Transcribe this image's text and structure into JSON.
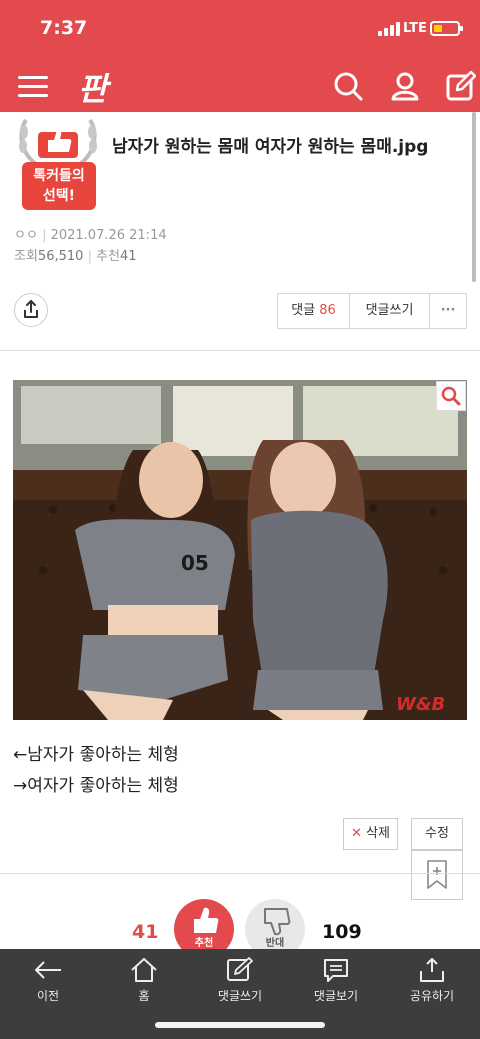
{
  "status_bar": {
    "time": "7:37",
    "network": "LTE"
  },
  "header": {
    "logo": "판"
  },
  "article": {
    "badge": {
      "line1": "톡커들의",
      "line2": "선택!"
    },
    "title": "남자가 원하는 몸매 여자가 원하는 몸매.jpg",
    "author": "ㅇㅇ",
    "date": "2021.07.26 21:14",
    "views_label": "조회",
    "views": "56,510",
    "recommend_label": "추천",
    "recommend": "41"
  },
  "actions": {
    "reply_label": "댓글",
    "reply_count": "86",
    "write_reply": "댓글쓰기",
    "more": "···"
  },
  "content": {
    "line1": "←남자가 좋아하는 체형",
    "line2": "→여자가 좋아하는 체형",
    "watermark": "W&B"
  },
  "edit": {
    "delete": "삭제",
    "modify": "수정"
  },
  "votes": {
    "up_count": "41",
    "up_label": "추천",
    "down_label": "반대",
    "down_count": "109",
    "up_color": "#e34a4d",
    "down_color": "#e8e8e8"
  },
  "tab_bar": {
    "items": [
      {
        "label": "이전",
        "icon": "back-arrow-icon"
      },
      {
        "label": "홈",
        "icon": "home-icon"
      },
      {
        "label": "댓글쓰기",
        "icon": "write-comment-icon"
      },
      {
        "label": "댓글보기",
        "icon": "view-comments-icon"
      },
      {
        "label": "공유하기",
        "icon": "share-icon"
      }
    ]
  }
}
